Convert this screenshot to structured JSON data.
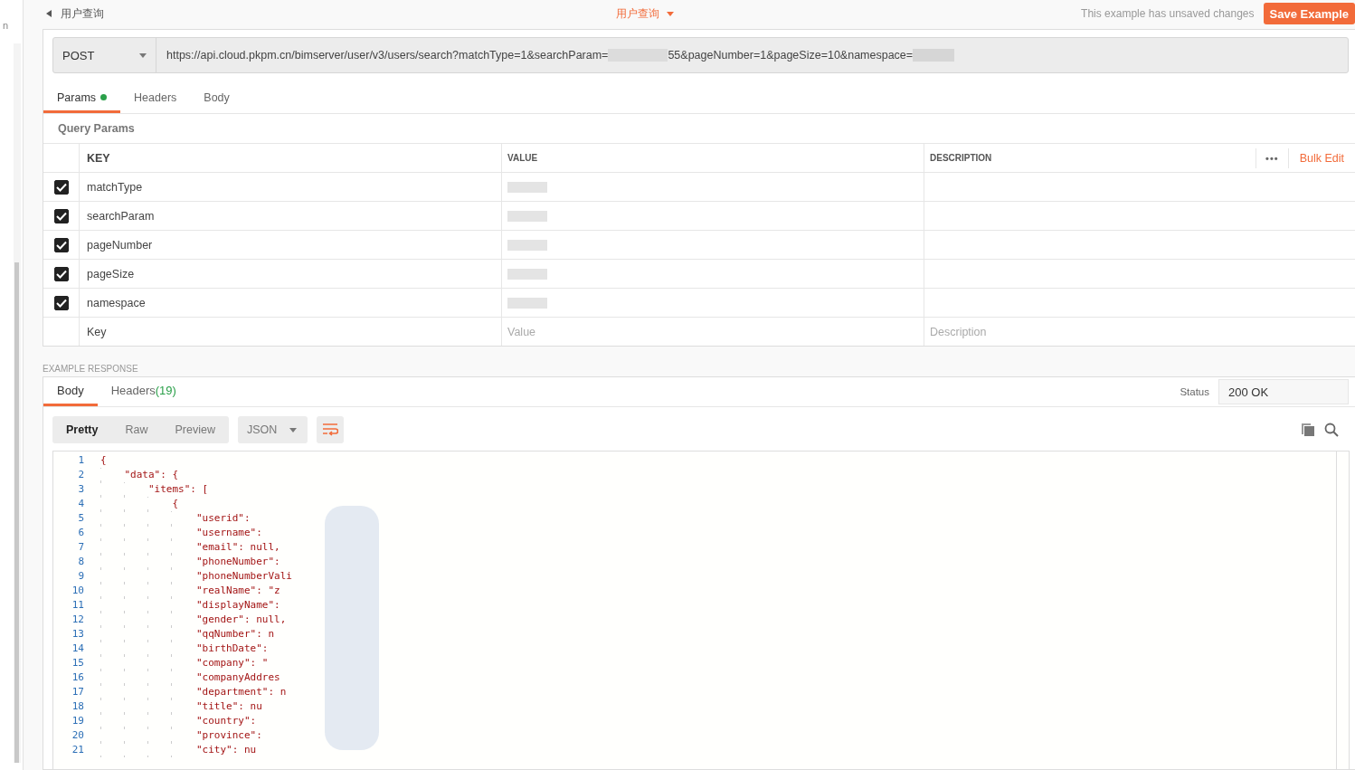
{
  "sidebar": {
    "fragment": "n"
  },
  "header": {
    "back_title": "用户查询",
    "center_title": "用户查询",
    "notice": "This example has unsaved changes",
    "save_button": "Save Example"
  },
  "request": {
    "method": "POST",
    "url": "https://api.cloud.pkpm.cn/bimserver/user/v3/users/search?matchType=1&searchParam=",
    "url_after_redaction": "55&pageNumber=1&pageSize=10&namespace="
  },
  "request_tabs": [
    {
      "label": "Params",
      "selected": true,
      "dot": true
    },
    {
      "label": "Headers",
      "selected": false,
      "dot": false
    },
    {
      "label": "Body",
      "selected": false,
      "dot": false
    }
  ],
  "query_params": {
    "title": "Query Params",
    "columns": [
      "KEY",
      "VALUE",
      "DESCRIPTION"
    ],
    "more": "•••",
    "bulk_edit": "Bulk Edit",
    "rows": [
      {
        "key": "matchType",
        "checked": true
      },
      {
        "key": "searchParam",
        "checked": true
      },
      {
        "key": "pageNumber",
        "checked": true
      },
      {
        "key": "pageSize",
        "checked": true
      },
      {
        "key": "namespace",
        "checked": true
      }
    ],
    "new_row": {
      "key_placeholder": "Key",
      "value_placeholder": "Value",
      "description_placeholder": "Description"
    }
  },
  "example_response": {
    "label": "EXAMPLE RESPONSE",
    "tabs": [
      {
        "label": "Body",
        "selected": true
      },
      {
        "label": "Headers",
        "count": "(19)",
        "selected": false
      }
    ],
    "status_label": "Status",
    "status": "200 OK",
    "view_modes": [
      {
        "label": "Pretty",
        "selected": true
      },
      {
        "label": "Raw",
        "selected": false
      },
      {
        "label": "Preview",
        "selected": false
      }
    ],
    "format": "JSON",
    "code": [
      {
        "n": "1",
        "text": "{"
      },
      {
        "n": "2",
        "text": "    \"data\": {"
      },
      {
        "n": "3",
        "text": "        \"items\": ["
      },
      {
        "n": "4",
        "text": "            {"
      },
      {
        "n": "5",
        "text": "                \"userid\":"
      },
      {
        "n": "6",
        "text": "                \"username\":"
      },
      {
        "n": "7",
        "text": "                \"email\": null,"
      },
      {
        "n": "8",
        "text": "                \"phoneNumber\":"
      },
      {
        "n": "9",
        "text": "                \"phoneNumberVali"
      },
      {
        "n": "10",
        "text": "                \"realName\": \"z"
      },
      {
        "n": "11",
        "text": "                \"displayName\":"
      },
      {
        "n": "12",
        "text": "                \"gender\": null,"
      },
      {
        "n": "13",
        "text": "                \"qqNumber\": n"
      },
      {
        "n": "14",
        "text": "                \"birthDate\":"
      },
      {
        "n": "15",
        "text": "                \"company\": \""
      },
      {
        "n": "16",
        "text": "                \"companyAddres"
      },
      {
        "n": "17",
        "text": "                \"department\": n"
      },
      {
        "n": "18",
        "text": "                \"title\": nu"
      },
      {
        "n": "19",
        "text": "                \"country\":"
      },
      {
        "n": "20",
        "text": "                \"province\":"
      },
      {
        "n": "21",
        "text": "                \"city\": nu"
      }
    ]
  }
}
